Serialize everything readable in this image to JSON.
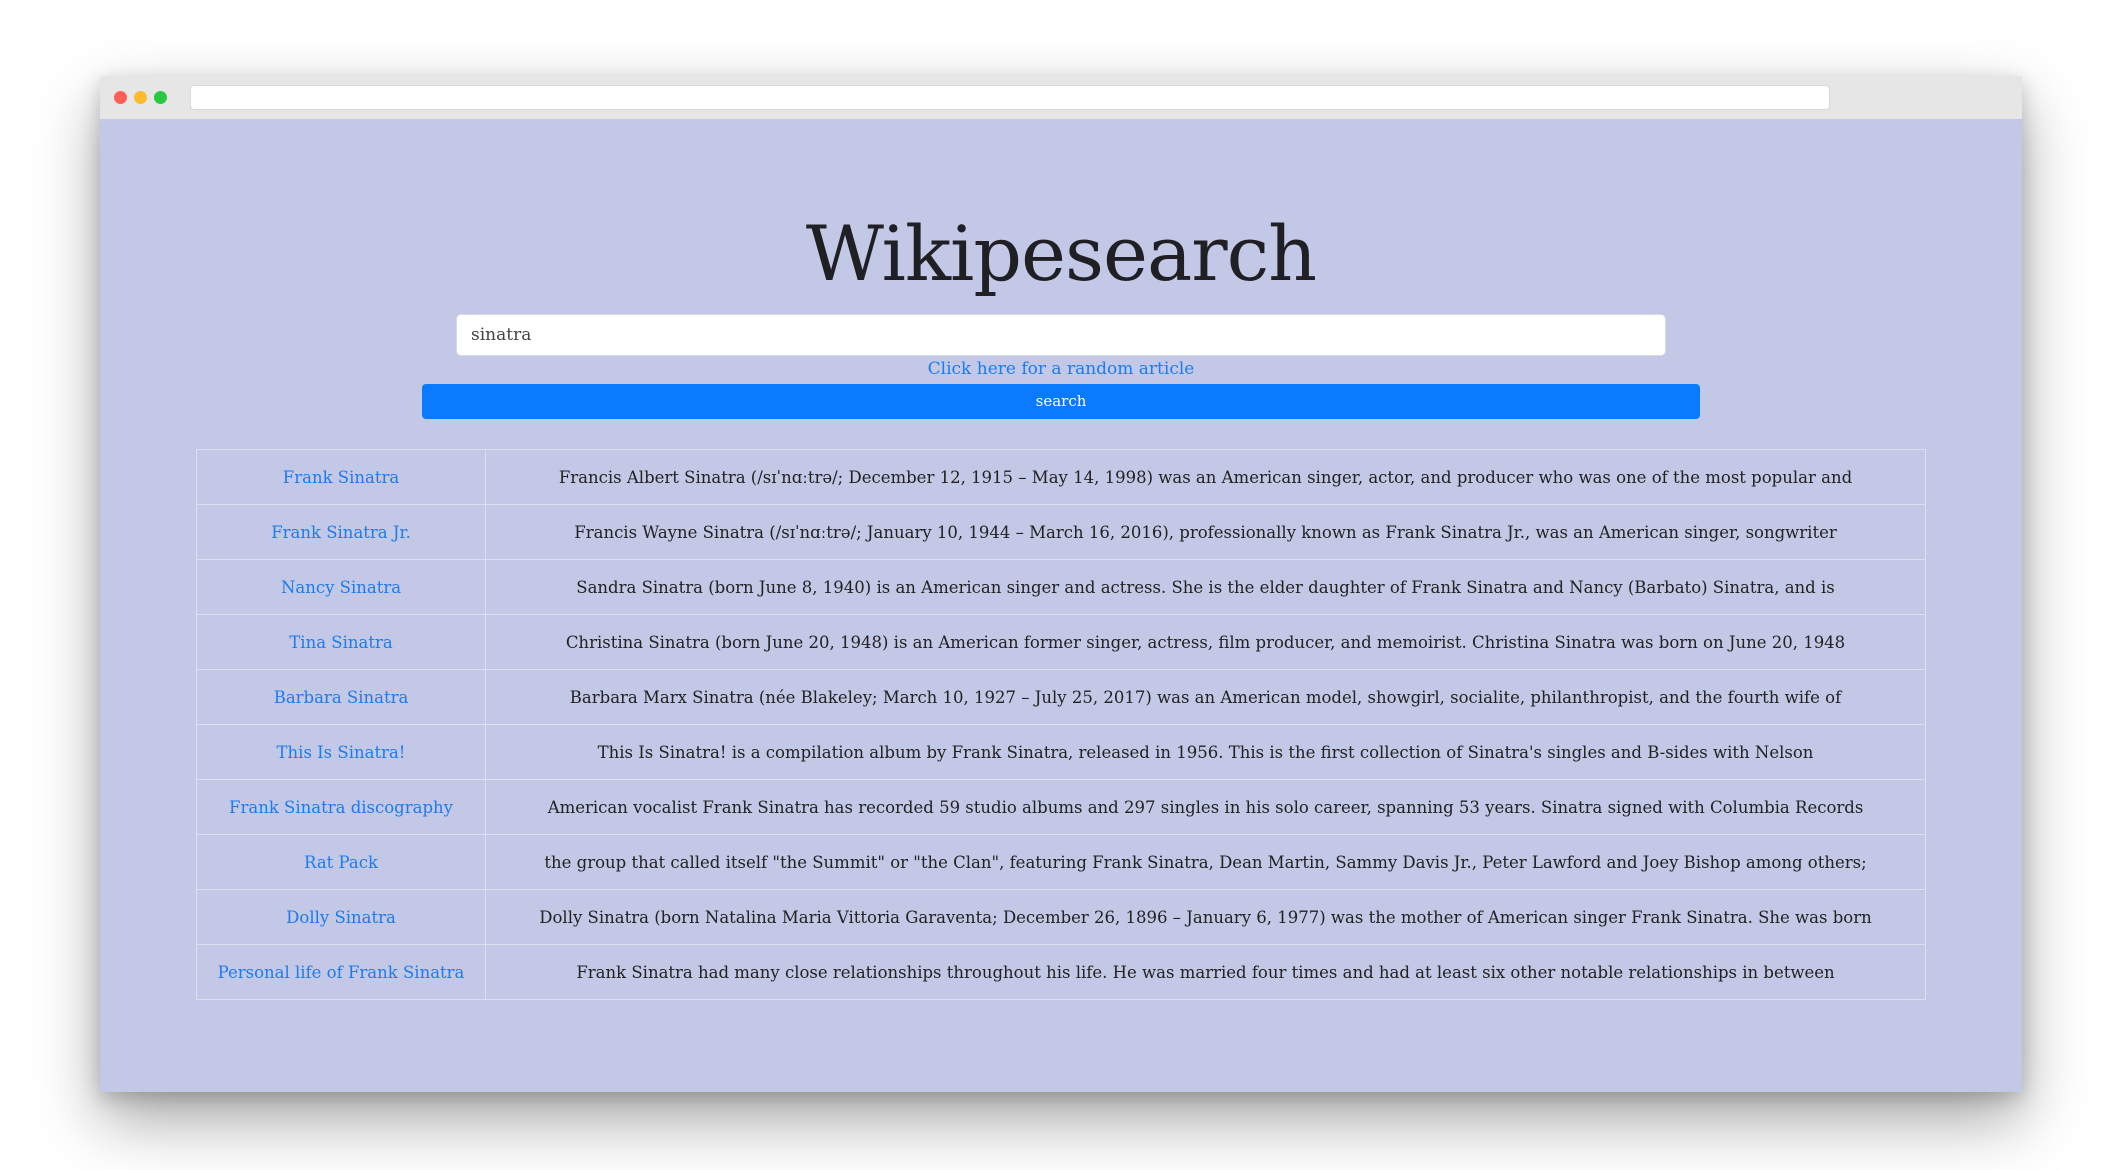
{
  "window": {
    "traffic_lights": {
      "close_color": "#fe5f57",
      "minimize_color": "#febb2e",
      "maximize_color": "#28c840"
    },
    "url": ""
  },
  "page": {
    "title": "Wikipesearch",
    "search": {
      "value": "sinatra",
      "placeholder": ""
    },
    "random_link": "Click here for a random article",
    "search_button": "search",
    "colors": {
      "background": "#c2c8e6",
      "accent": "#0a7bff",
      "link": "#1d7bf0"
    },
    "results": [
      {
        "title": "Frank Sinatra",
        "snippet": "Francis Albert Sinatra (/sɪˈnɑːtrə/; December 12, 1915 – May 14, 1998) was an American singer, actor, and producer who was one of the most popular and"
      },
      {
        "title": "Frank Sinatra Jr.",
        "snippet": "Francis Wayne Sinatra (/sɪˈnɑːtrə/; January 10, 1944 – March 16, 2016), professionally known as Frank Sinatra Jr., was an American singer, songwriter"
      },
      {
        "title": "Nancy Sinatra",
        "snippet": "Sandra Sinatra (born June 8, 1940) is an American singer and actress. She is the elder daughter of Frank Sinatra and Nancy (Barbato) Sinatra, and is"
      },
      {
        "title": "Tina Sinatra",
        "snippet": "Christina Sinatra (born June 20, 1948) is an American former singer, actress, film producer, and memoirist. Christina Sinatra was born on June 20, 1948"
      },
      {
        "title": "Barbara Sinatra",
        "snippet": "Barbara Marx Sinatra (née Blakeley; March 10, 1927 – July 25, 2017) was an American model, showgirl, socialite, philanthropist, and the fourth wife of"
      },
      {
        "title": "This Is Sinatra!",
        "snippet": "This Is Sinatra! is a compilation album by Frank Sinatra, released in 1956. This is the first collection of Sinatra's singles and B-sides with Nelson"
      },
      {
        "title": "Frank Sinatra discography",
        "snippet": "American vocalist Frank Sinatra has recorded 59 studio albums and 297 singles in his solo career, spanning 53 years. Sinatra signed with Columbia Records"
      },
      {
        "title": "Rat Pack",
        "snippet": "the group that called itself \"the Summit\" or \"the Clan\", featuring Frank Sinatra, Dean Martin, Sammy Davis Jr., Peter Lawford and Joey Bishop among others;"
      },
      {
        "title": "Dolly Sinatra",
        "snippet": "Dolly Sinatra (born Natalina Maria Vittoria Garaventa; December 26, 1896 – January 6, 1977) was the mother of American singer Frank Sinatra. She was born"
      },
      {
        "title": "Personal life of Frank Sinatra",
        "snippet": "Frank Sinatra had many close relationships throughout his life. He was married four times and had at least six other notable relationships in between"
      }
    ]
  }
}
